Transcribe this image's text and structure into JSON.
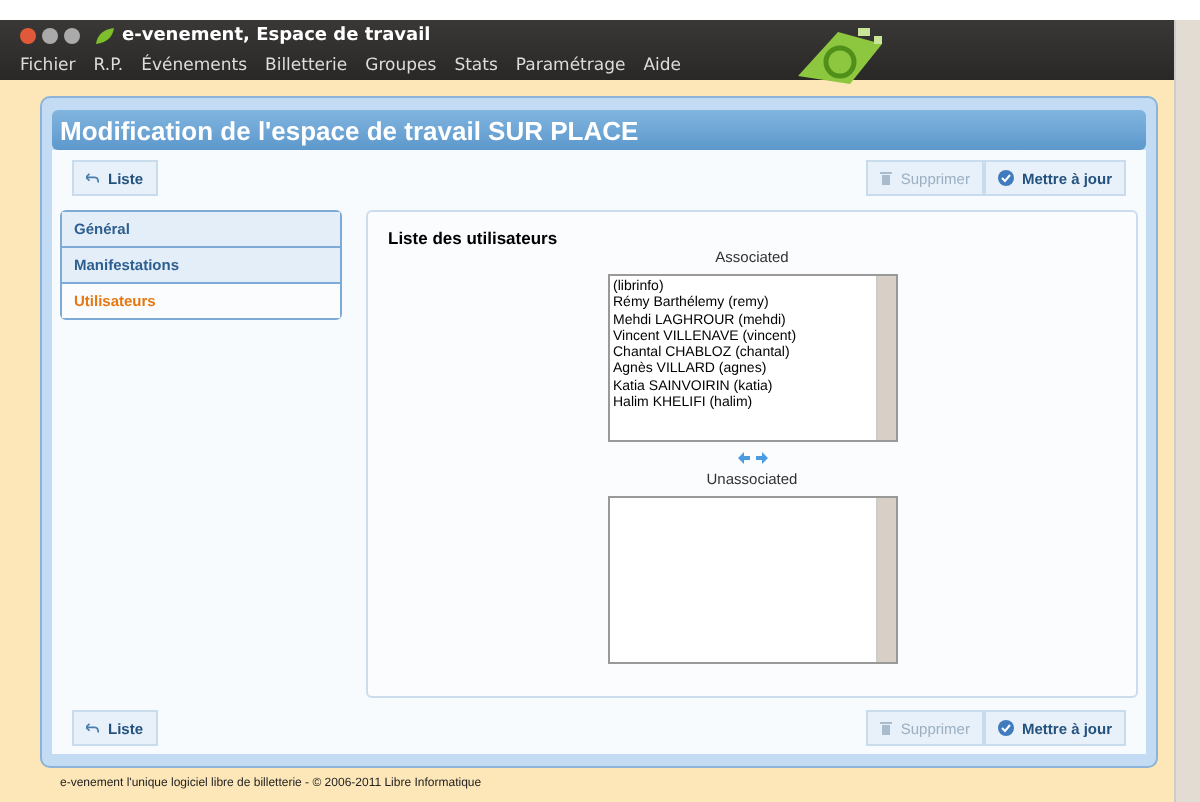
{
  "window": {
    "title": "e-venement, Espace de travail"
  },
  "menu": [
    "Fichier",
    "R.P.",
    "Événements",
    "Billetterie",
    "Groupes",
    "Stats",
    "Paramétrage",
    "Aide"
  ],
  "page_title": "Modification de l'espace de travail SUR PLACE",
  "top_actions": [
    {
      "label": "Liste",
      "kind": "back",
      "disabled": false
    },
    {
      "label": "Supprimer",
      "kind": "delete",
      "disabled": true
    },
    {
      "label": "Mettre à jour",
      "kind": "save",
      "disabled": false
    }
  ],
  "tabs": [
    {
      "label": "Général",
      "selected": false
    },
    {
      "label": "Manifestations",
      "selected": false
    },
    {
      "label": "Utilisateurs",
      "selected": true
    }
  ],
  "section_title": "Liste des utilisateurs",
  "associated": {
    "label": "Associated",
    "items": [
      "(librinfo)",
      "Rémy Barthélemy (remy)",
      "Mehdi LAGHROUR (mehdi)",
      "Vincent VILLENAVE (vincent)",
      "Chantal CHABLOZ (chantal)",
      "Agnès VILLARD (agnes)",
      "Katia SAINVOIRIN (katia)",
      "Halim KHELIFI (halim)"
    ]
  },
  "unassociated": {
    "label": "Unassociated"
  },
  "bottom_actions": [
    {
      "label": "Liste",
      "kind": "back",
      "disabled": false
    },
    {
      "label": "Supprimer",
      "kind": "delete",
      "disabled": true
    },
    {
      "label": "Mettre à jour",
      "kind": "save",
      "disabled": false
    }
  ],
  "footer": "e-venement l'unique logiciel libre de billetterie - © 2006-2011 Libre Informatique"
}
